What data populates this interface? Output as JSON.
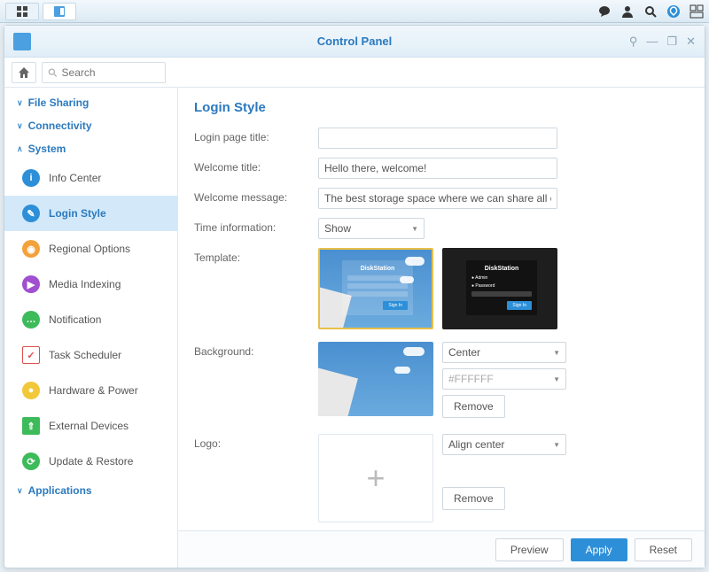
{
  "window": {
    "title": "Control Panel"
  },
  "search": {
    "placeholder": "Search"
  },
  "sidebar": {
    "groups": [
      {
        "label": "File Sharing",
        "expanded": false
      },
      {
        "label": "Connectivity",
        "expanded": false
      },
      {
        "label": "System",
        "expanded": true
      },
      {
        "label": "Applications",
        "expanded": false
      }
    ],
    "system_items": [
      {
        "label": "Info Center",
        "icon_color": "#2d8fd8"
      },
      {
        "label": "Login Style",
        "icon_color": "#2d8fd8",
        "selected": true
      },
      {
        "label": "Regional Options",
        "icon_color": "#f2a23a"
      },
      {
        "label": "Media Indexing",
        "icon_color": "#a04fd0"
      },
      {
        "label": "Notification",
        "icon_color": "#3dbb5a"
      },
      {
        "label": "Task Scheduler",
        "icon_color": "#e05050"
      },
      {
        "label": "Hardware & Power",
        "icon_color": "#f2c83a"
      },
      {
        "label": "External Devices",
        "icon_color": "#3dbb5a"
      },
      {
        "label": "Update & Restore",
        "icon_color": "#3dbb5a"
      }
    ]
  },
  "page": {
    "heading": "Login Style",
    "labels": {
      "login_page_title": "Login page title:",
      "welcome_title": "Welcome title:",
      "welcome_message": "Welcome message:",
      "time_info": "Time information:",
      "template": "Template:",
      "background": "Background:",
      "logo": "Logo:"
    },
    "values": {
      "login_page_title": "",
      "welcome_title": "Hello there, welcome!",
      "welcome_message": "The best storage space where we can share all our m",
      "time_info": "Show",
      "bg_position": "Center",
      "bg_color": "#FFFFFF",
      "logo_align": "Align center"
    },
    "template_preview": {
      "title": "DiskStation",
      "user": "Admin",
      "pass": "Password",
      "signin": "Sign In"
    },
    "buttons": {
      "remove": "Remove",
      "preview": "Preview",
      "apply": "Apply",
      "reset": "Reset"
    }
  }
}
